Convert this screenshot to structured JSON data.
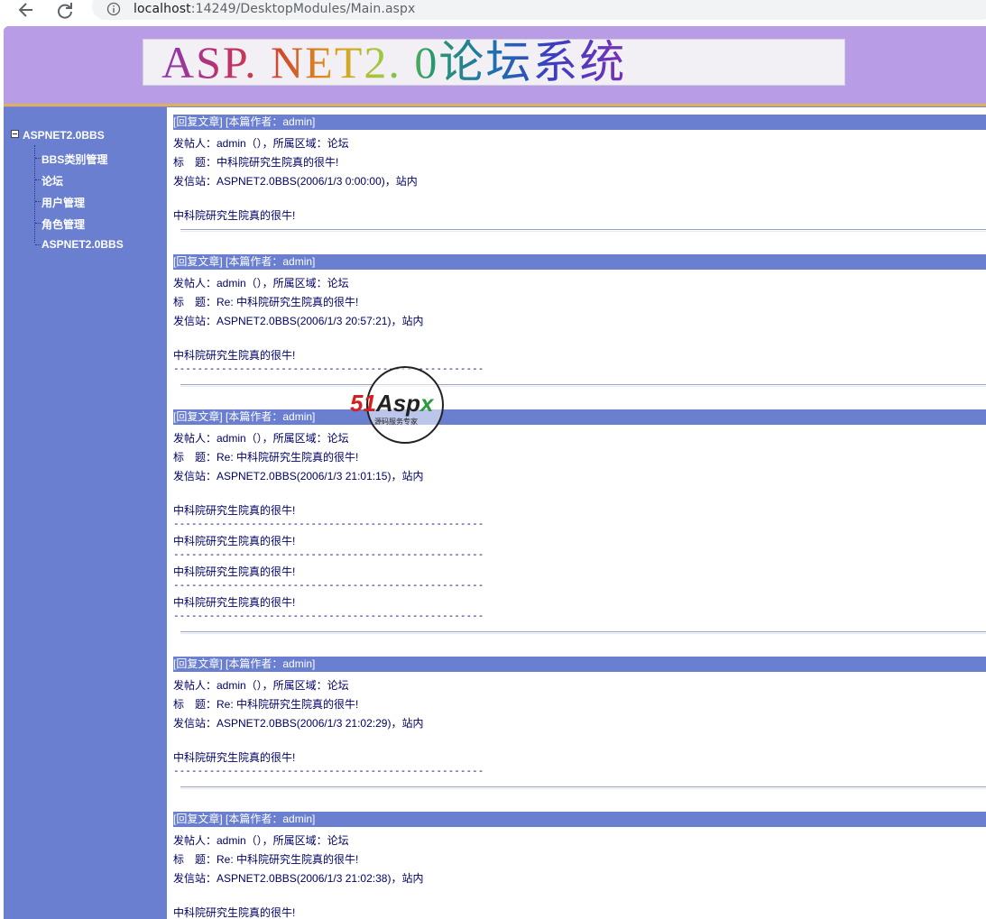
{
  "browser": {
    "url_host": "localhost",
    "url_rest": ":14249/DesktopModules/Main.aspx"
  },
  "banner": {
    "text": "ASP. NET2. 0论坛系统"
  },
  "sidebar": {
    "root": "ASPNET2.0BBS",
    "items": [
      {
        "label": "BBS类别管理"
      },
      {
        "label": "论坛"
      },
      {
        "label": "用户管理"
      },
      {
        "label": "角色管理"
      },
      {
        "label": "ASPNET2.0BBS"
      }
    ]
  },
  "posts": [
    {
      "reply_label": "[回复文章]",
      "author_label": "[本篇作者：admin]",
      "poster": "发帖人：admin（），所属区域：论坛",
      "title": "标　题：中科院研究生院真的很牛!",
      "station": "发信站：ASPNET2.0BBS(2006/1/3 0:00:00)，站内",
      "body": [
        "中科院研究生院真的很牛!"
      ],
      "dashes": "----------------------------------------------------"
    },
    {
      "reply_label": "[回复文章]",
      "author_label": "[本篇作者：admin]",
      "poster": "发帖人：admin（），所属区域：论坛",
      "title": "标　题：Re: 中科院研究生院真的很牛!",
      "station": "发信站：ASPNET2.0BBS(2006/1/3 20:57:21)，站内",
      "body": [
        "中科院研究生院真的很牛!"
      ],
      "dashes": "----------------------------------------------------"
    },
    {
      "reply_label": "[回复文章]",
      "author_label": "[本篇作者：admin]",
      "poster": "发帖人：admin（），所属区域：论坛",
      "title": "标　题：Re: 中科院研究生院真的很牛!",
      "station": "发信站：ASPNET2.0BBS(2006/1/3 21:01:15)，站内",
      "body": [
        "中科院研究生院真的很牛!",
        "中科院研究生院真的很牛!",
        "中科院研究生院真的很牛!",
        "中科院研究生院真的很牛!"
      ],
      "dashes": "----------------------------------------------------"
    },
    {
      "reply_label": "[回复文章]",
      "author_label": "[本篇作者：admin]",
      "poster": "发帖人：admin（），所属区域：论坛",
      "title": "标　题：Re: 中科院研究生院真的很牛!",
      "station": "发信站：ASPNET2.0BBS(2006/1/3 21:02:29)，站内",
      "body": [
        "中科院研究生院真的很牛!"
      ],
      "dashes": "----------------------------------------------------"
    },
    {
      "reply_label": "[回复文章]",
      "author_label": "[本篇作者：admin]",
      "poster": "发帖人：admin（），所属区域：论坛",
      "title": "标　题：Re: 中科院研究生院真的很牛!",
      "station": "发信站：ASPNET2.0BBS(2006/1/3 21:02:38)，站内",
      "body": [
        "中科院研究生院真的很牛!"
      ],
      "dashes": "----------------------------------------------------"
    }
  ],
  "watermark": {
    "logo": "51Aspx",
    "tagline": "源码服务专家"
  }
}
